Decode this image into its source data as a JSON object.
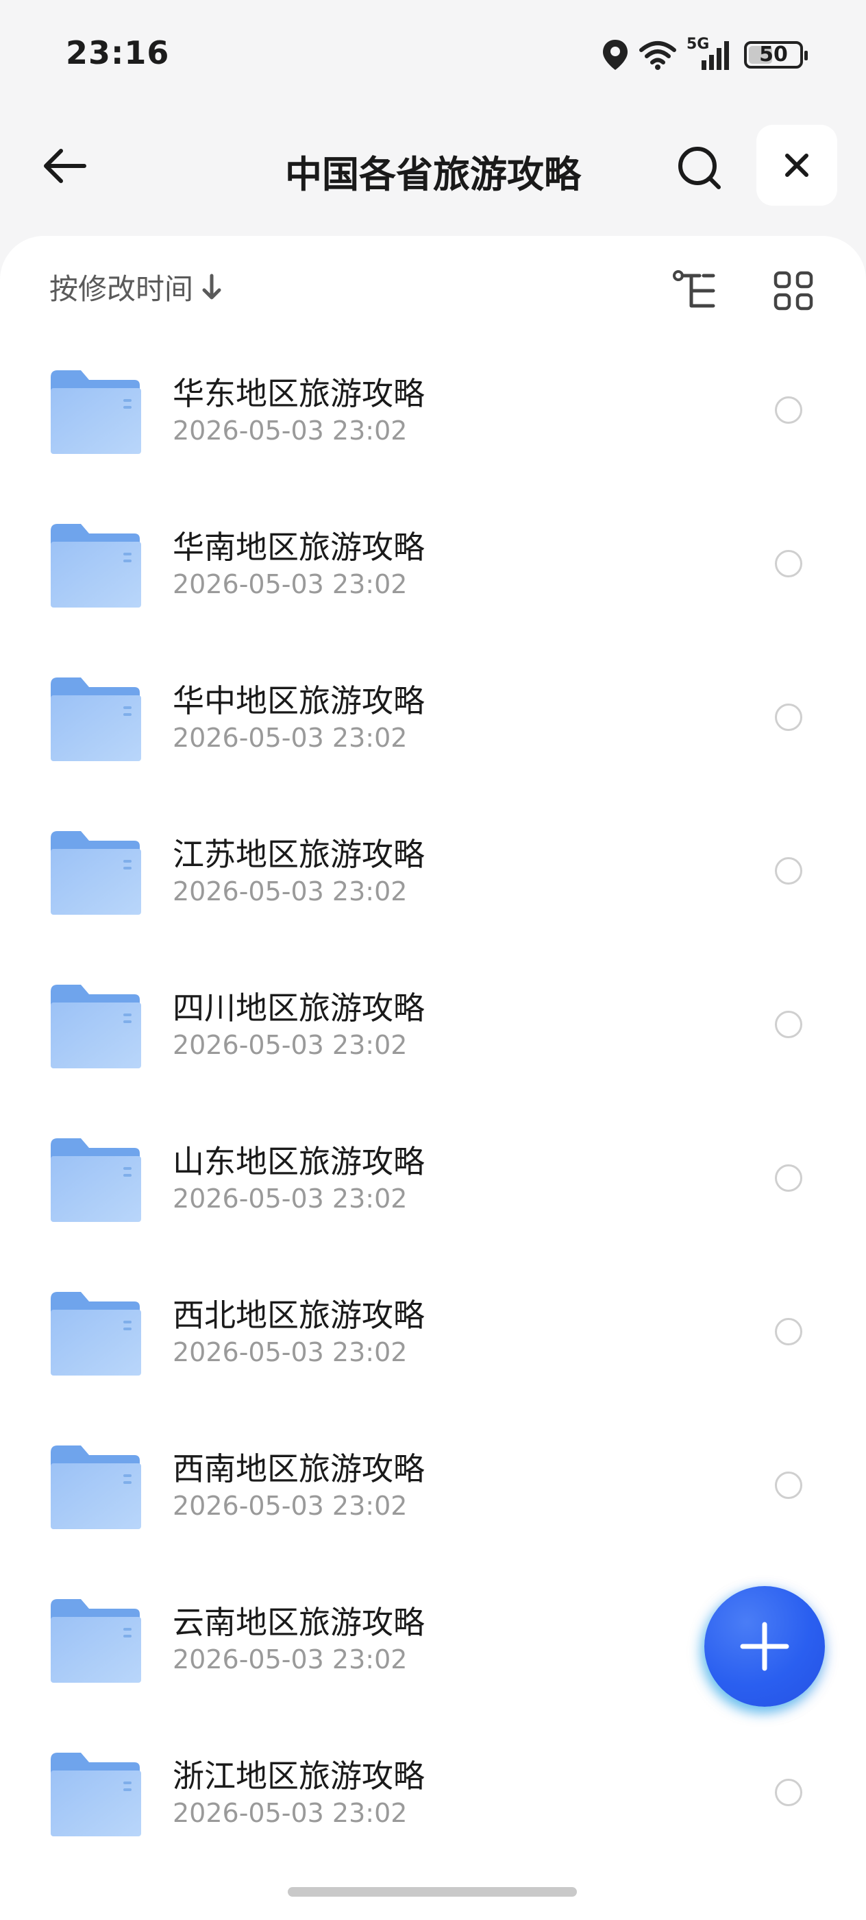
{
  "status_bar": {
    "time": "23:16",
    "network": "5G",
    "battery": "50",
    "battery_level": 0.5
  },
  "header": {
    "title": "中国各省旅游攻略"
  },
  "toolbar": {
    "sort_label": "按修改时间"
  },
  "files": [
    {
      "name": "华东地区旅游攻略",
      "date": "2026-05-03 23:02"
    },
    {
      "name": "华南地区旅游攻略",
      "date": "2026-05-03 23:02"
    },
    {
      "name": "华中地区旅游攻略",
      "date": "2026-05-03 23:02"
    },
    {
      "name": "江苏地区旅游攻略",
      "date": "2026-05-03 23:02"
    },
    {
      "name": "四川地区旅游攻略",
      "date": "2026-05-03 23:02"
    },
    {
      "name": "山东地区旅游攻略",
      "date": "2026-05-03 23:02"
    },
    {
      "name": "西北地区旅游攻略",
      "date": "2026-05-03 23:02"
    },
    {
      "name": "西南地区旅游攻略",
      "date": "2026-05-03 23:02"
    },
    {
      "name": "云南地区旅游攻略",
      "date": "2026-05-03 23:02"
    },
    {
      "name": "浙江地区旅游攻略",
      "date": "2026-05-03 23:02"
    }
  ],
  "colors": {
    "accent": "#2a5ff0",
    "folder_top": "#6fa4ec",
    "folder_body": "#a9ccf7"
  }
}
